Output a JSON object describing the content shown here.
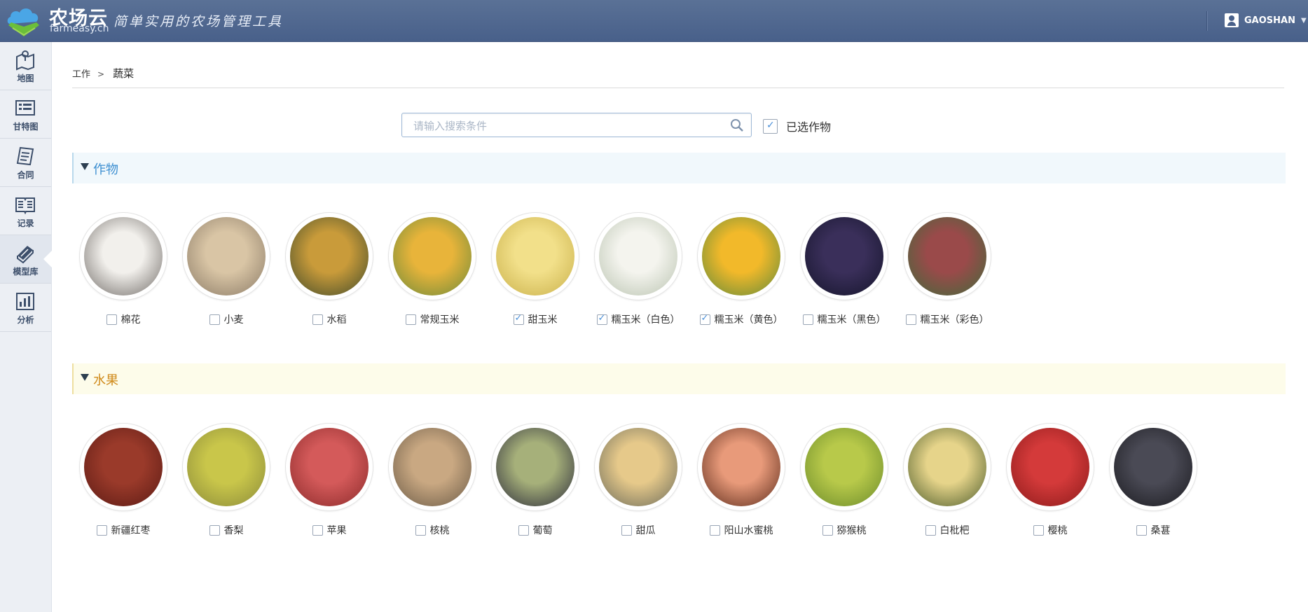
{
  "header": {
    "title": "农场云",
    "domain": "farmeasy.cn",
    "slogan": "简单实用的农场管理工具",
    "user": "GAOSHAN"
  },
  "sidebar": {
    "items": [
      {
        "label": "地图",
        "icon": "map-icon",
        "active": false
      },
      {
        "label": "甘特图",
        "icon": "gantt-icon",
        "active": false
      },
      {
        "label": "合同",
        "icon": "contract-icon",
        "active": false
      },
      {
        "label": "记录",
        "icon": "record-icon",
        "active": false
      },
      {
        "label": "模型库",
        "icon": "model-library-icon",
        "active": true
      },
      {
        "label": "分析",
        "icon": "analysis-icon",
        "active": false
      }
    ]
  },
  "breadcrumb": {
    "root": "工作",
    "sep": ">",
    "current": "蔬菜"
  },
  "search": {
    "placeholder": "请输入搜索条件",
    "value": ""
  },
  "selected_filter": {
    "label": "已选作物",
    "checked": true
  },
  "sections": {
    "crops": {
      "title": "作物",
      "items": [
        {
          "label": "棉花",
          "checked": false,
          "colors": [
            "#6f6a66",
            "#f2f0ec"
          ]
        },
        {
          "label": "小麦",
          "checked": false,
          "colors": [
            "#8a7a66",
            "#d9c5a5"
          ]
        },
        {
          "label": "水稻",
          "checked": false,
          "colors": [
            "#3f4a2a",
            "#c99b3a"
          ]
        },
        {
          "label": "常规玉米",
          "checked": false,
          "colors": [
            "#6b8a3a",
            "#e8b43a"
          ]
        },
        {
          "label": "甜玉米",
          "checked": true,
          "colors": [
            "#c9b04a",
            "#f2e08a"
          ]
        },
        {
          "label": "糯玉米（白色）",
          "checked": true,
          "colors": [
            "#b9c3b0",
            "#f4f4ee"
          ]
        },
        {
          "label": "糯玉米（黄色）",
          "checked": true,
          "colors": [
            "#5f8a3a",
            "#f2b92a"
          ]
        },
        {
          "label": "糯玉米（黑色）",
          "checked": false,
          "colors": [
            "#14142a",
            "#3a2f5a"
          ]
        },
        {
          "label": "糯玉米（彩色）",
          "checked": false,
          "colors": [
            "#3f6a3a",
            "#9a4a4a"
          ]
        }
      ]
    },
    "fruits": {
      "title": "水果",
      "items": [
        {
          "label": "新疆红枣",
          "checked": false,
          "colors": [
            "#5a1a14",
            "#9a3a2a"
          ]
        },
        {
          "label": "香梨",
          "checked": false,
          "colors": [
            "#8a8a3a",
            "#c9c64a"
          ]
        },
        {
          "label": "苹果",
          "checked": false,
          "colors": [
            "#8a2a2a",
            "#d45a5a"
          ]
        },
        {
          "label": "核桃",
          "checked": false,
          "colors": [
            "#6a5a46",
            "#c9a882"
          ]
        },
        {
          "label": "葡萄",
          "checked": false,
          "colors": [
            "#2a2a3a",
            "#a6b07a"
          ]
        },
        {
          "label": "甜瓜",
          "checked": false,
          "colors": [
            "#6a6a5a",
            "#e6c98a"
          ]
        },
        {
          "label": "阳山水蜜桃",
          "checked": false,
          "colors": [
            "#5a2a1a",
            "#e89a7a"
          ]
        },
        {
          "label": "猕猴桃",
          "checked": false,
          "colors": [
            "#6a8a2a",
            "#b8c94a"
          ]
        },
        {
          "label": "白枇杷",
          "checked": false,
          "colors": [
            "#4a5a2a",
            "#e6d48a"
          ]
        },
        {
          "label": "樱桃",
          "checked": false,
          "colors": [
            "#8a1a1a",
            "#d43a3a"
          ]
        },
        {
          "label": "桑葚",
          "checked": false,
          "colors": [
            "#1a1a1f",
            "#4a4a55"
          ]
        }
      ]
    }
  }
}
